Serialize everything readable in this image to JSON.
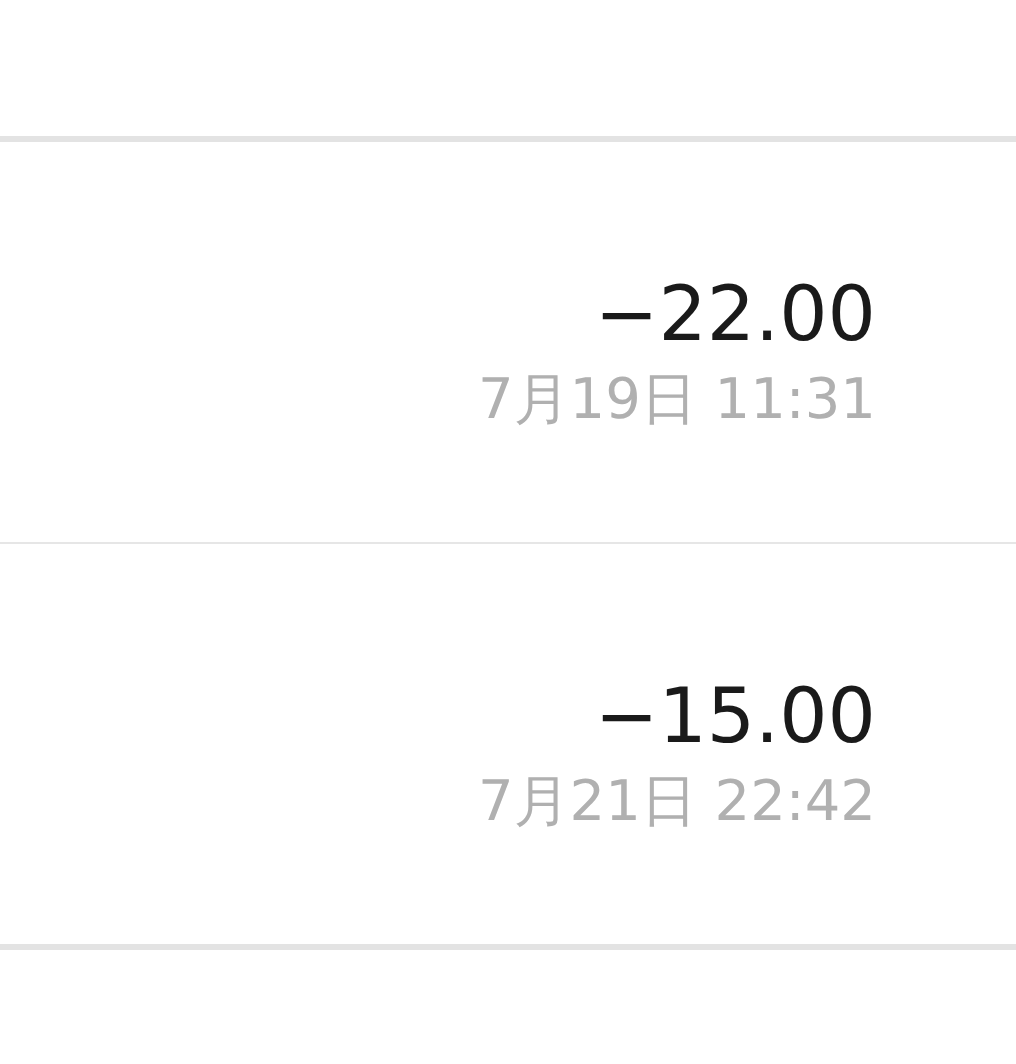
{
  "transactions": [
    {
      "amount": "−22.00",
      "time": "7月19日 11:31"
    },
    {
      "amount": "−15.00",
      "time": "7月21日 22:42"
    }
  ]
}
